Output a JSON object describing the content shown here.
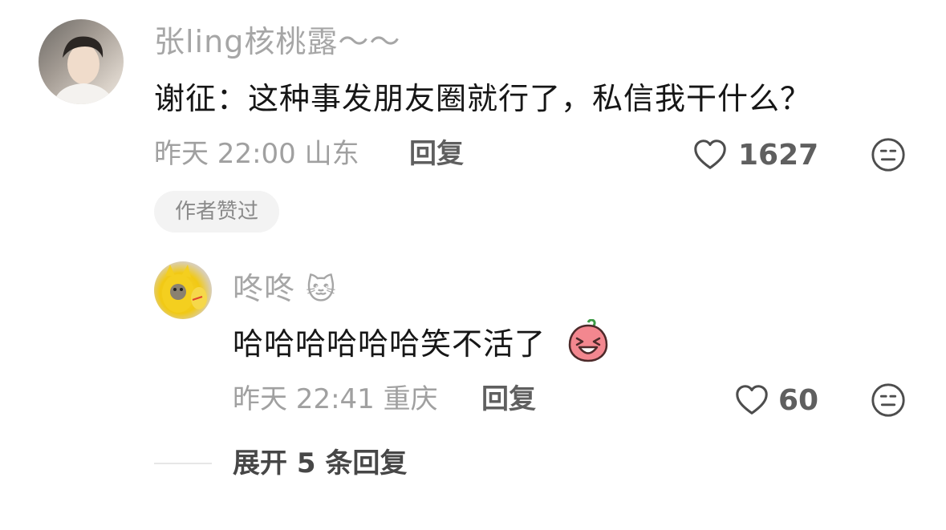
{
  "comment": {
    "username": "张ling核桃露～～",
    "text": "谢征：这种事发朋友圈就行了，私信我干什么？",
    "meta": "昨天 22:00 山东",
    "reply_label": "回复",
    "likes": "1627",
    "author_badge": "作者赞过"
  },
  "reply": {
    "username": "咚咚",
    "username_emoji": "🐱",
    "text": "哈哈哈哈哈哈笑不活了",
    "meta": "昨天 22:41 重庆",
    "reply_label": "回复",
    "likes": "60"
  },
  "expand": {
    "label": "展开 5 条回复"
  },
  "icons": {
    "like": "heart-outline-icon",
    "dislike": "meh-face-icon",
    "sticker": "laughing-peach-sticker"
  },
  "colors": {
    "username": "#a6a6a6",
    "text": "#161616",
    "meta": "#a0a0a0",
    "badge_bg": "#f3f3f3"
  }
}
